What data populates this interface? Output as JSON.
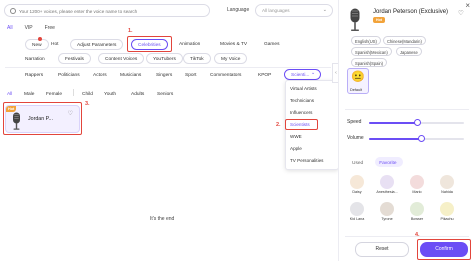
{
  "search": {
    "placeholder": "Your 1200+ voices, please enter the voice name to search"
  },
  "language": {
    "label": "Language",
    "value": "All languages"
  },
  "tier_tabs": [
    "All",
    "VIP",
    "Free"
  ],
  "category_chips": [
    "New",
    "Hot",
    "Adjust Parameters",
    "Celebrities",
    "Animation",
    "Movies & TV",
    "Games",
    "Narration",
    "Festivals",
    "Content Voices",
    "YouTubers",
    "TikTok",
    "My Voice"
  ],
  "subcategory_row": [
    "Rappers",
    "Politicians",
    "Actors",
    "Musicians",
    "Singers",
    "Sport",
    "Commentators",
    "KPOP",
    "Scienti..."
  ],
  "gender_row": [
    "All",
    "Male",
    "Female",
    "Child",
    "Youth",
    "Adults",
    "Seniors"
  ],
  "dropdown_items": [
    "Virtual Artists",
    "Technicians",
    "Influencers",
    "Scientists",
    "WWE",
    "Apple",
    "TV Personalities"
  ],
  "voice_card": {
    "badge": "Hot",
    "name": "Jordan P..."
  },
  "end_text": "It's the end",
  "step_markers": [
    "1.",
    "2.",
    "3.",
    "4."
  ],
  "right_panel": {
    "name": "Jordan Peterson (Exclusive)",
    "badge": "Hot",
    "languages": [
      "English(US)",
      "Chinese(Mandarin)",
      "Spanish(Mexican)",
      "Japanese",
      "Spanish(Spain)"
    ],
    "style_label": "Default",
    "speed_label": "Speed",
    "volume_label": "Volume",
    "speed_value": 0.5,
    "volume_value": 0.55,
    "tabs": [
      "Used",
      "Favorite"
    ],
    "favorites": [
      "Daisy",
      "Anesthesia...",
      "Mario",
      "Nahida",
      "Kid Lana",
      "Tyrone",
      "Bowser",
      "Pikachu"
    ],
    "reset_label": "Reset",
    "confirm_label": "Confirm"
  },
  "colors": {
    "accent": "#6b4df5",
    "annotation": "#e2453c",
    "hot_badge": "#f2a33a"
  }
}
